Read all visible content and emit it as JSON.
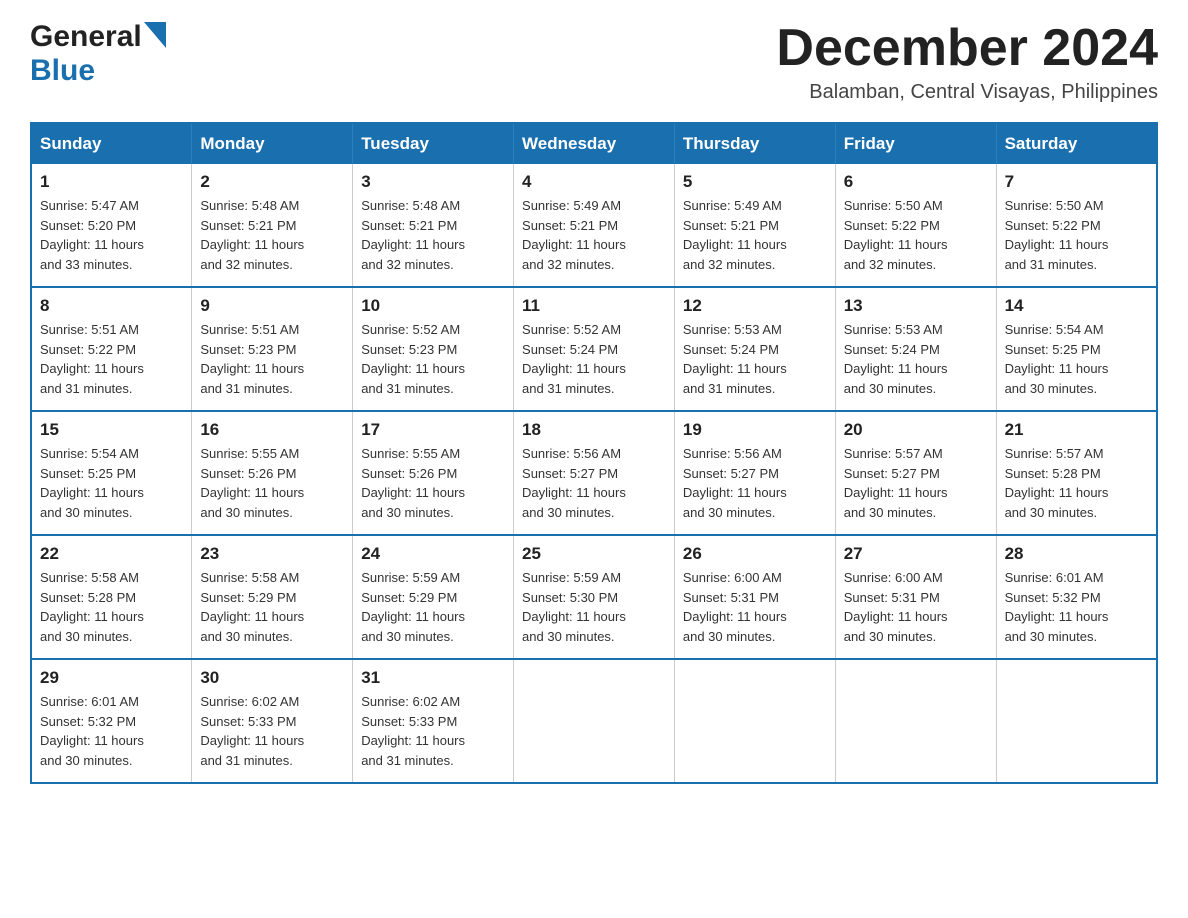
{
  "header": {
    "logo_general": "General",
    "logo_blue": "Blue",
    "month_title": "December 2024",
    "subtitle": "Balamban, Central Visayas, Philippines"
  },
  "days_of_week": [
    "Sunday",
    "Monday",
    "Tuesday",
    "Wednesday",
    "Thursday",
    "Friday",
    "Saturday"
  ],
  "weeks": [
    [
      {
        "day": "1",
        "info": "Sunrise: 5:47 AM\nSunset: 5:20 PM\nDaylight: 11 hours\nand 33 minutes."
      },
      {
        "day": "2",
        "info": "Sunrise: 5:48 AM\nSunset: 5:21 PM\nDaylight: 11 hours\nand 32 minutes."
      },
      {
        "day": "3",
        "info": "Sunrise: 5:48 AM\nSunset: 5:21 PM\nDaylight: 11 hours\nand 32 minutes."
      },
      {
        "day": "4",
        "info": "Sunrise: 5:49 AM\nSunset: 5:21 PM\nDaylight: 11 hours\nand 32 minutes."
      },
      {
        "day": "5",
        "info": "Sunrise: 5:49 AM\nSunset: 5:21 PM\nDaylight: 11 hours\nand 32 minutes."
      },
      {
        "day": "6",
        "info": "Sunrise: 5:50 AM\nSunset: 5:22 PM\nDaylight: 11 hours\nand 32 minutes."
      },
      {
        "day": "7",
        "info": "Sunrise: 5:50 AM\nSunset: 5:22 PM\nDaylight: 11 hours\nand 31 minutes."
      }
    ],
    [
      {
        "day": "8",
        "info": "Sunrise: 5:51 AM\nSunset: 5:22 PM\nDaylight: 11 hours\nand 31 minutes."
      },
      {
        "day": "9",
        "info": "Sunrise: 5:51 AM\nSunset: 5:23 PM\nDaylight: 11 hours\nand 31 minutes."
      },
      {
        "day": "10",
        "info": "Sunrise: 5:52 AM\nSunset: 5:23 PM\nDaylight: 11 hours\nand 31 minutes."
      },
      {
        "day": "11",
        "info": "Sunrise: 5:52 AM\nSunset: 5:24 PM\nDaylight: 11 hours\nand 31 minutes."
      },
      {
        "day": "12",
        "info": "Sunrise: 5:53 AM\nSunset: 5:24 PM\nDaylight: 11 hours\nand 31 minutes."
      },
      {
        "day": "13",
        "info": "Sunrise: 5:53 AM\nSunset: 5:24 PM\nDaylight: 11 hours\nand 30 minutes."
      },
      {
        "day": "14",
        "info": "Sunrise: 5:54 AM\nSunset: 5:25 PM\nDaylight: 11 hours\nand 30 minutes."
      }
    ],
    [
      {
        "day": "15",
        "info": "Sunrise: 5:54 AM\nSunset: 5:25 PM\nDaylight: 11 hours\nand 30 minutes."
      },
      {
        "day": "16",
        "info": "Sunrise: 5:55 AM\nSunset: 5:26 PM\nDaylight: 11 hours\nand 30 minutes."
      },
      {
        "day": "17",
        "info": "Sunrise: 5:55 AM\nSunset: 5:26 PM\nDaylight: 11 hours\nand 30 minutes."
      },
      {
        "day": "18",
        "info": "Sunrise: 5:56 AM\nSunset: 5:27 PM\nDaylight: 11 hours\nand 30 minutes."
      },
      {
        "day": "19",
        "info": "Sunrise: 5:56 AM\nSunset: 5:27 PM\nDaylight: 11 hours\nand 30 minutes."
      },
      {
        "day": "20",
        "info": "Sunrise: 5:57 AM\nSunset: 5:27 PM\nDaylight: 11 hours\nand 30 minutes."
      },
      {
        "day": "21",
        "info": "Sunrise: 5:57 AM\nSunset: 5:28 PM\nDaylight: 11 hours\nand 30 minutes."
      }
    ],
    [
      {
        "day": "22",
        "info": "Sunrise: 5:58 AM\nSunset: 5:28 PM\nDaylight: 11 hours\nand 30 minutes."
      },
      {
        "day": "23",
        "info": "Sunrise: 5:58 AM\nSunset: 5:29 PM\nDaylight: 11 hours\nand 30 minutes."
      },
      {
        "day": "24",
        "info": "Sunrise: 5:59 AM\nSunset: 5:29 PM\nDaylight: 11 hours\nand 30 minutes."
      },
      {
        "day": "25",
        "info": "Sunrise: 5:59 AM\nSunset: 5:30 PM\nDaylight: 11 hours\nand 30 minutes."
      },
      {
        "day": "26",
        "info": "Sunrise: 6:00 AM\nSunset: 5:31 PM\nDaylight: 11 hours\nand 30 minutes."
      },
      {
        "day": "27",
        "info": "Sunrise: 6:00 AM\nSunset: 5:31 PM\nDaylight: 11 hours\nand 30 minutes."
      },
      {
        "day": "28",
        "info": "Sunrise: 6:01 AM\nSunset: 5:32 PM\nDaylight: 11 hours\nand 30 minutes."
      }
    ],
    [
      {
        "day": "29",
        "info": "Sunrise: 6:01 AM\nSunset: 5:32 PM\nDaylight: 11 hours\nand 30 minutes."
      },
      {
        "day": "30",
        "info": "Sunrise: 6:02 AM\nSunset: 5:33 PM\nDaylight: 11 hours\nand 31 minutes."
      },
      {
        "day": "31",
        "info": "Sunrise: 6:02 AM\nSunset: 5:33 PM\nDaylight: 11 hours\nand 31 minutes."
      },
      {
        "day": "",
        "info": ""
      },
      {
        "day": "",
        "info": ""
      },
      {
        "day": "",
        "info": ""
      },
      {
        "day": "",
        "info": ""
      }
    ]
  ]
}
